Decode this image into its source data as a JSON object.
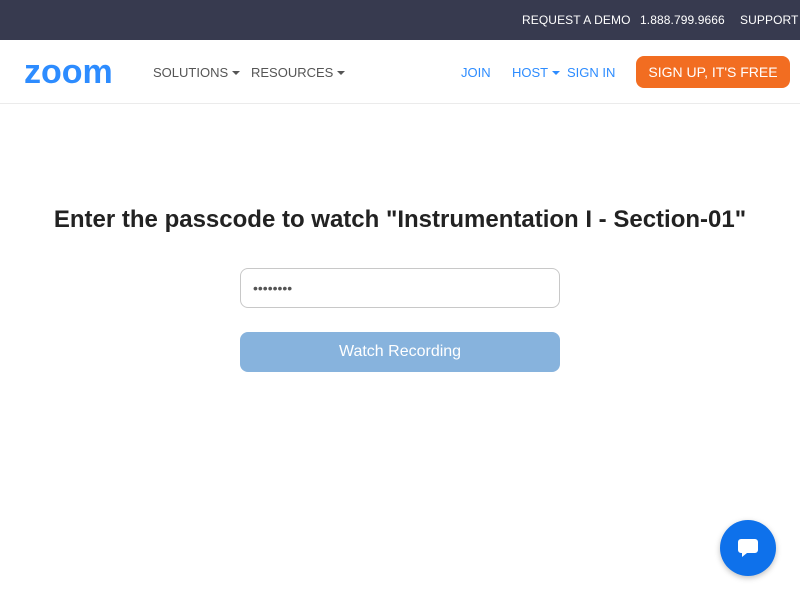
{
  "topbar": {
    "request_demo": "REQUEST A DEMO",
    "phone": "1.888.799.9666",
    "support": "SUPPORT"
  },
  "nav": {
    "logo_text": "zoom",
    "solutions": "SOLUTIONS",
    "resources": "RESOURCES",
    "join": "JOIN",
    "host": "HOST",
    "sign_in": "SIGN IN",
    "sign_up": "SIGN UP, IT'S FREE"
  },
  "main": {
    "heading": "Enter the passcode to watch \"Instrumentation I - Section-01\"",
    "passcode_value": "••••••••",
    "watch_button": "Watch Recording"
  },
  "chat": {
    "icon": "chat-bubble-icon"
  },
  "colors": {
    "topbar_bg": "#373a4f",
    "brand_blue": "#2d8cff",
    "signup_orange": "#f26d21",
    "watch_button_disabled": "#87b3dd",
    "chat_blue": "#0e71eb"
  }
}
